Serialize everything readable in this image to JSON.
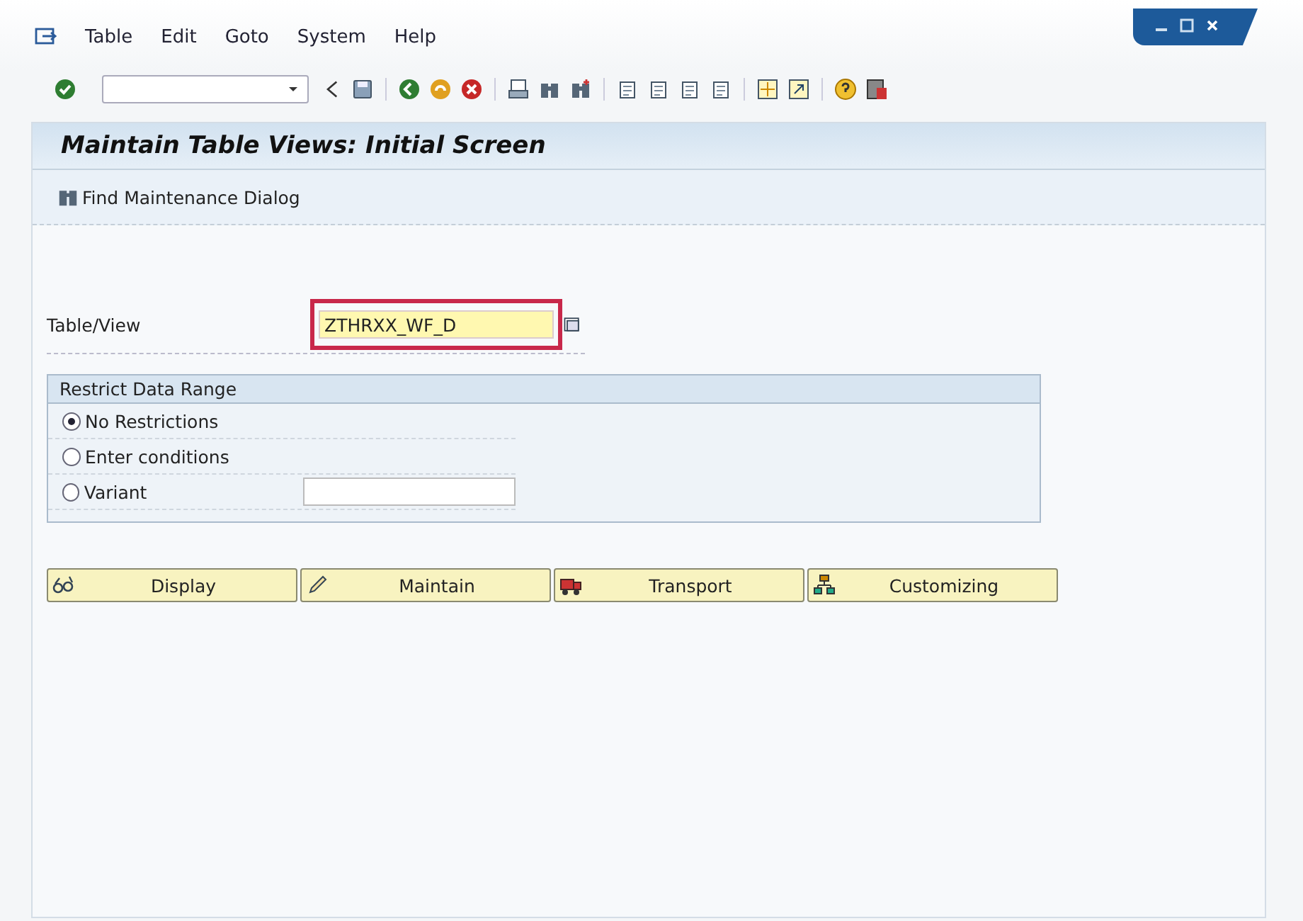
{
  "menu": [
    {
      "label": "Table"
    },
    {
      "label": "Edit"
    },
    {
      "label": "Goto"
    },
    {
      "label": "System"
    },
    {
      "label": "Help"
    }
  ],
  "screen": {
    "title": "Maintain Table Views: Initial Screen"
  },
  "app_toolbar": [
    {
      "label": "Find Maintenance Dialog"
    }
  ],
  "table_view": {
    "label": "Table/View",
    "value": "ZTHRXX_WF_D",
    "highlighted": true
  },
  "restrict_group": {
    "title": "Restrict Data Range",
    "options": [
      {
        "label": "No Restrictions",
        "selected": true
      },
      {
        "label": "Enter conditions",
        "selected": false
      },
      {
        "label": "Variant",
        "selected": false,
        "kind": "field"
      }
    ]
  },
  "buttons": [
    {
      "label": "Display",
      "kind": "glasses"
    },
    {
      "label": "Maintain",
      "kind": "pencil"
    },
    {
      "label": "Transport",
      "kind": "truck"
    },
    {
      "label": "Customizing",
      "kind": "hierarchy"
    }
  ]
}
